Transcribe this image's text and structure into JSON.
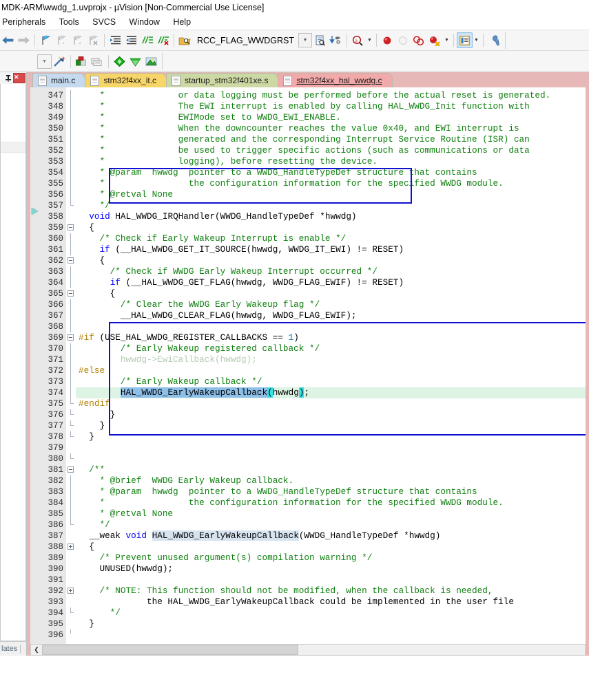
{
  "window": {
    "title": "MDK-ARM\\wwdg_1.uvprojx - µVision  [Non-Commercial Use License]"
  },
  "menubar": {
    "items": [
      {
        "label": "Peripherals"
      },
      {
        "label": "Tools"
      },
      {
        "label": "SVCS"
      },
      {
        "label": "Window"
      },
      {
        "label": "Help"
      }
    ]
  },
  "toolbar1": {
    "back_icon": "back-arrow-icon",
    "forward_icon": "forward-arrow-icon",
    "bookmark_toggle_icon": "bookmark-toggle-icon",
    "bookmark_prev_icon": "bookmark-previous-icon",
    "bookmark_next_icon": "bookmark-next-icon",
    "bookmark_clear_icon": "bookmark-clear-icon",
    "indent_icon": "indent-right-icon",
    "outdent_icon": "indent-left-icon",
    "comment_icon": "comment-lines-icon",
    "uncomment_icon": "uncomment-lines-icon",
    "find_in_files_icon": "find-in-files-icon",
    "search_value": "RCC_FLAG_WWDGRST",
    "search_dropdown_icon": "chevron-down-icon",
    "browse_icon": "browse-symbol-icon",
    "goto_definition_icon": "goto-definition-icon",
    "magnifier_icon": "search-magnifier-icon",
    "magnifier_caret_icon": "chevron-down-icon",
    "breakpoint_icon": "insert-breakpoint-icon",
    "breakpoint_disable_icon": "disable-breakpoint-icon",
    "breakpoint_killall_icon": "kill-all-breakpoints-icon",
    "breakpoint_disableall_icon": "disable-all-breakpoints-icon",
    "breakpoint_caret_icon": "chevron-down-icon",
    "window_layout_icon": "manage-windows-icon",
    "window_layout_caret_icon": "chevron-down-icon",
    "configure_icon": "configure-wrench-icon"
  },
  "toolbar2": {
    "target_dropdown_icon": "chevron-down-icon",
    "target_options_icon": "target-options-wand-icon",
    "manage_runtime_icon": "manage-runtime-environment-icon",
    "batch_build_icon": "batch-build-icon",
    "download_icon": "download-to-flash-icon",
    "debug_icon": "start-debug-session-icon",
    "multi_project_icon": "multi-project-icon"
  },
  "left_panel": {
    "pin_icon": "pin-icon",
    "close_icon": "close-icon",
    "bottom_tab_label": "lates",
    "bottom_tab_full": "Templates"
  },
  "editor": {
    "tabs": [
      {
        "label": "main.c",
        "icon": "file-icon",
        "active": false,
        "color": "#c5d9ef"
      },
      {
        "label": "stm32f4xx_it.c",
        "icon": "file-icon",
        "active": false,
        "color": "#f8d568"
      },
      {
        "label": "startup_stm32f401xe.s",
        "icon": "file-icon",
        "active": false,
        "color": "#cdd9a5"
      },
      {
        "label": "stm32f4xx_hal_wwdg.c",
        "icon": "file-icon",
        "active": true,
        "color": "#f2a9a9"
      }
    ],
    "current_line": 374,
    "execution_marker_line": 358,
    "scrollbar": {
      "left_arrow_icon": "chevron-left-icon"
    },
    "annotations": [
      {
        "name": "early-wakeup-callback-call-box",
        "top_line": 372,
        "bottom_line": 375,
        "color": "#1010d0"
      },
      {
        "name": "weak-callback-definition-box",
        "top_line": 386,
        "bottom_line": 396,
        "color": "#1010d0"
      }
    ],
    "first_line": 347,
    "lines": [
      {
        "n": 347,
        "text": "    *              or data logging must be performed before the actual reset is generated."
      },
      {
        "n": 348,
        "text": "    *              The EWI interrupt is enabled by calling HAL_WWDG_Init function with"
      },
      {
        "n": 349,
        "text": "    *              EWIMode set to WWDG_EWI_ENABLE."
      },
      {
        "n": 350,
        "text": "    *              When the downcounter reaches the value 0x40, and EWI interrupt is"
      },
      {
        "n": 351,
        "text": "    *              generated and the corresponding Interrupt Service Routine (ISR) can"
      },
      {
        "n": 352,
        "text": "    *              be used to trigger specific actions (such as communications or data"
      },
      {
        "n": 353,
        "text": "    *              logging), before resetting the device."
      },
      {
        "n": 354,
        "text": "    * @param  hwwdg  pointer to a WWDG_HandleTypeDef structure that contains"
      },
      {
        "n": 355,
        "text": "    *                the configuration information for the specified WWDG module."
      },
      {
        "n": 356,
        "text": "    * @retval None"
      },
      {
        "n": 357,
        "text": "    */"
      },
      {
        "n": 358,
        "text": "  void HAL_WWDG_IRQHandler(WWDG_HandleTypeDef *hwwdg)"
      },
      {
        "n": 359,
        "text": "  {"
      },
      {
        "n": 360,
        "text": "    /* Check if Early Wakeup Interrupt is enable */"
      },
      {
        "n": 361,
        "text": "    if (__HAL_WWDG_GET_IT_SOURCE(hwwdg, WWDG_IT_EWI) != RESET)"
      },
      {
        "n": 362,
        "text": "    {"
      },
      {
        "n": 363,
        "text": "      /* Check if WWDG Early Wakeup Interrupt occurred */"
      },
      {
        "n": 364,
        "text": "      if (__HAL_WWDG_GET_FLAG(hwwdg, WWDG_FLAG_EWIF) != RESET)"
      },
      {
        "n": 365,
        "text": "      {"
      },
      {
        "n": 366,
        "text": "        /* Clear the WWDG Early Wakeup flag */"
      },
      {
        "n": 367,
        "text": "        __HAL_WWDG_CLEAR_FLAG(hwwdg, WWDG_FLAG_EWIF);"
      },
      {
        "n": 368,
        "text": ""
      },
      {
        "n": 369,
        "text": "#if (USE_HAL_WWDG_REGISTER_CALLBACKS == 1)"
      },
      {
        "n": 370,
        "text": "        /* Early Wakeup registered callback */"
      },
      {
        "n": 371,
        "text": "        hwwdg->EwiCallback(hwwdg);"
      },
      {
        "n": 372,
        "text": "#else"
      },
      {
        "n": 373,
        "text": "        /* Early Wakeup callback */"
      },
      {
        "n": 374,
        "text": "        HAL_WWDG_EarlyWakeupCallback(hwwdg);"
      },
      {
        "n": 375,
        "text": "#endif"
      },
      {
        "n": 376,
        "text": "      }"
      },
      {
        "n": 377,
        "text": "    }"
      },
      {
        "n": 378,
        "text": "  }"
      },
      {
        "n": 379,
        "text": ""
      },
      {
        "n": 380,
        "text": ""
      },
      {
        "n": 381,
        "text": "  /**"
      },
      {
        "n": 382,
        "text": "    * @brief  WWDG Early Wakeup callback."
      },
      {
        "n": 383,
        "text": "    * @param  hwwdg  pointer to a WWDG_HandleTypeDef structure that contains"
      },
      {
        "n": 384,
        "text": "    *                the configuration information for the specified WWDG module."
      },
      {
        "n": 385,
        "text": "    * @retval None"
      },
      {
        "n": 386,
        "text": "    */"
      },
      {
        "n": 387,
        "text": "  __weak void HAL_WWDG_EarlyWakeupCallback(WWDG_HandleTypeDef *hwwdg)"
      },
      {
        "n": 388,
        "text": "  {"
      },
      {
        "n": 389,
        "text": "    /* Prevent unused argument(s) compilation warning */"
      },
      {
        "n": 390,
        "text": "    UNUSED(hwwdg);"
      },
      {
        "n": 391,
        "text": ""
      },
      {
        "n": 392,
        "text": "    /* NOTE: This function should not be modified, when the callback is needed,"
      },
      {
        "n": 393,
        "text": "             the HAL_WWDG_EarlyWakeupCallback could be implemented in the user file"
      },
      {
        "n": 394,
        "text": "      */"
      },
      {
        "n": 395,
        "text": "  }"
      },
      {
        "n": 396,
        "text": ""
      }
    ]
  }
}
